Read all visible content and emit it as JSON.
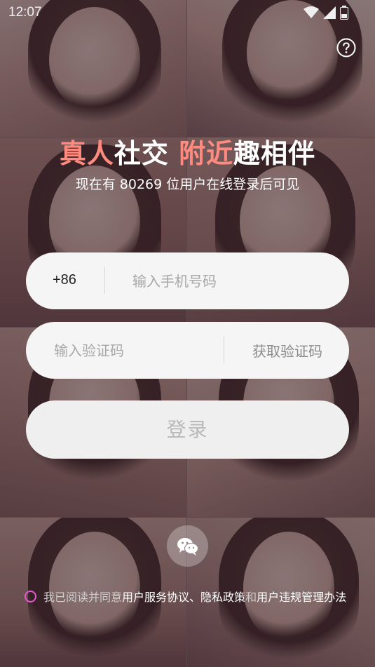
{
  "status": {
    "time": "12:07"
  },
  "headline": {
    "part1": "真人",
    "part2": "社交 ",
    "part3": "附近",
    "part4": "趣相伴"
  },
  "subtitle": "现在有 80269 位用户在线登录后可见",
  "phone": {
    "country_code": "+86",
    "placeholder": "输入手机号码"
  },
  "code": {
    "placeholder": "输入验证码",
    "get_code_label": "获取验证码"
  },
  "login_label": "登录",
  "agreement": {
    "prefix": "我已阅读并同意",
    "link1": "用户服务协议",
    "sep1": "、",
    "link2": "隐私政策",
    "sep2": "和",
    "link3": "用户违规管理办法"
  },
  "icons": [
    "help-icon",
    "wechat-icon",
    "wifi-icon",
    "signal-icon",
    "battery-icon"
  ],
  "colors": {
    "accent": "#ff8a80",
    "checkbox": "#e25ad0"
  }
}
